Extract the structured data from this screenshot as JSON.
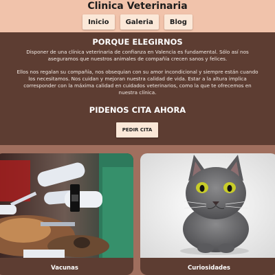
{
  "header": {
    "title": "Clinica Veterinaria",
    "nav": [
      "Inicio",
      "Galeria",
      "Blog"
    ]
  },
  "main": {
    "heading": "PORQUE ELEGIRNOS",
    "paragraph1": "Disponer de una clínica veterinaria de confianza en Valencia es fundamental. Sólo así nos aseguramos que nuestros animales de compañía crecen sanos y felices.",
    "paragraph2": "Ellos nos regalan su compañía, nos obsequian con su amor incondicional y siempre están cuando los necesitamos. Nos cuidan y mejoran nuestra calidad de vida. Estar a la altura implica corresponder con la máxima calidad en cuidados veterinarios, como la que te ofrecemos en nuestra clínica.",
    "cta_heading": "PIDENOS CITA AHORA",
    "cta_button": "PEDIR CITA"
  },
  "cards": [
    {
      "caption": "Vacunas"
    },
    {
      "caption": "Curiosidades"
    }
  ],
  "colors": {
    "header_bg": "#f1c3ab",
    "main_bg": "#5d3d32",
    "page_bg": "#a06f5e",
    "button_bg": "#fbe8d8"
  }
}
